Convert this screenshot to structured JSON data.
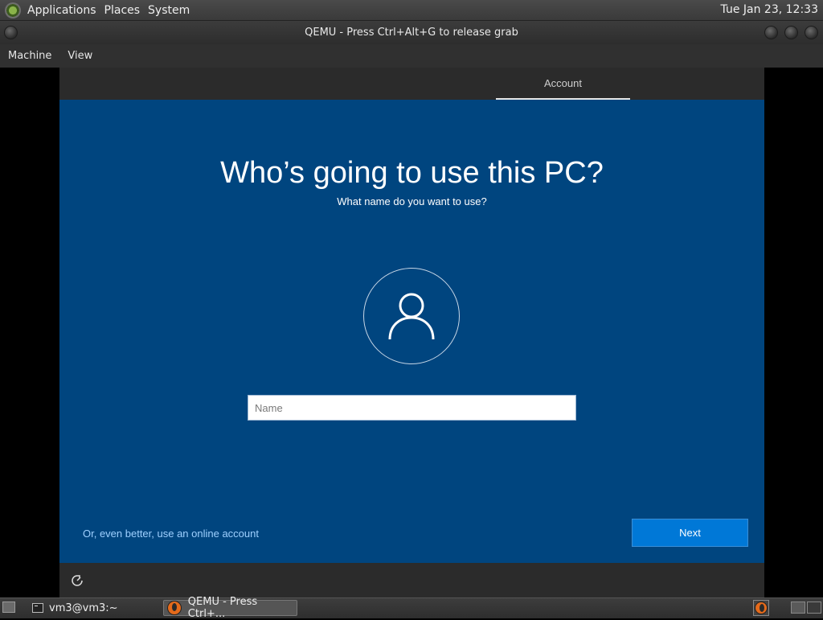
{
  "panel": {
    "menus": [
      "Applications",
      "Places",
      "System"
    ],
    "clock": "Tue Jan 23, 12:33"
  },
  "window": {
    "title": "QEMU - Press Ctrl+Alt+G to release grab",
    "menu": [
      "Machine",
      "View"
    ]
  },
  "oobe": {
    "tab": "Account",
    "heading": "Who’s going to use this PC?",
    "subheading": "What name do you want to use?",
    "name_placeholder": "Name",
    "name_value": "",
    "online_link": "Or, even better, use an online account",
    "next_label": "Next",
    "colors": {
      "background": "#00457f",
      "button": "#0078d7",
      "link": "#9fd0ff"
    }
  },
  "taskbar": {
    "tasks": [
      {
        "label": "vm3@vm3:~",
        "icon": "terminal-icon",
        "active": false
      },
      {
        "label": "QEMU - Press Ctrl+...",
        "icon": "qemu-icon",
        "active": true
      }
    ]
  }
}
